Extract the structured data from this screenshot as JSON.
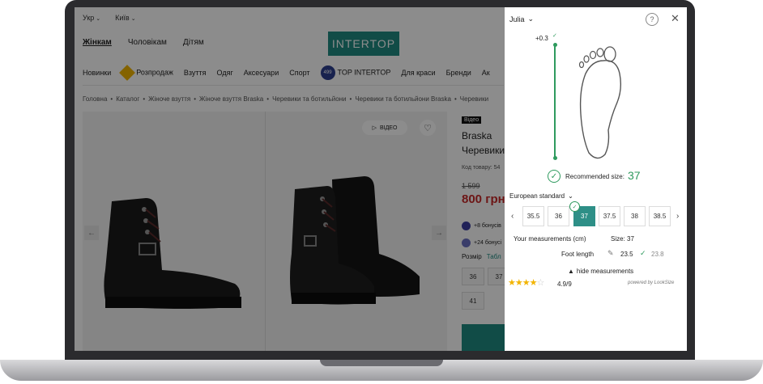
{
  "store": {
    "topbar": [
      "Укр",
      "Київ"
    ],
    "gender_nav": [
      "Жінкам",
      "Чоловікам",
      "Дітям"
    ],
    "logo": "INTERTOP",
    "category_nav": [
      "Новинки",
      "Розпродаж",
      "Взуття",
      "Одяг",
      "Аксесуари",
      "Спорт",
      "TOP INTERTOP",
      "Для краси",
      "Бренди",
      "Ак"
    ],
    "badge_499": "499",
    "breadcrumbs": [
      "Головна",
      "Каталог",
      "Жіноче взуття",
      "Жіноче взуття Braska",
      "Черевики та ботильйони",
      "Черевики та ботильйони Braska",
      "Черевики"
    ],
    "video_button": "ВІДЕО",
    "video_tag": "Відео",
    "brand": "Braska",
    "product_name": "Черевики",
    "code_label": "Код товару: 54",
    "old_price": "1 599",
    "price": "800 грн",
    "bonus": [
      "+8 бонусів",
      "+24 бонусі"
    ],
    "size_label": "Розмір",
    "size_table_link": "Табл",
    "sizes": [
      "36",
      "37",
      "41"
    ]
  },
  "widget": {
    "profile_name": "Julia",
    "help": "?",
    "close": "✕",
    "offset": "+0.3",
    "recommended_label": "Recommended size:",
    "recommended_size": "37",
    "standard": "European standard",
    "sizes": [
      "35.5",
      "36",
      "37",
      "37.5",
      "38",
      "38.5"
    ],
    "selected_size": "37",
    "measurements_title": "Your measurements (cm)",
    "size_summary": "Size: 37",
    "foot_length_label": "Foot length",
    "foot_length": "23.5",
    "foot_length_ref": "23.8",
    "hide_measurements": "hide measurements",
    "rating": "4.9/9",
    "rating_stars": 4.5,
    "powered_by": "powered by LookSize",
    "accent_color": "#2e8f87",
    "check_color": "#2e9a5e"
  }
}
